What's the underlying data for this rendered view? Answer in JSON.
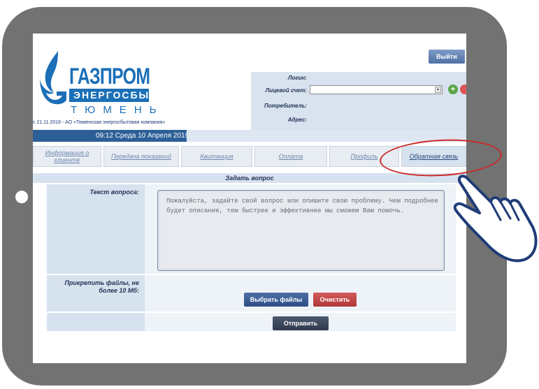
{
  "header": {
    "brand_main": "ГАЗПРОМ",
    "brand_sub": "ЭНЕРГОСБЫТ",
    "brand_city": "ТЮМЕНЬ",
    "company_line": "с 21.11.2018 - АО «Тюменская энергосбытовая компания»",
    "logout_label": "Выйти",
    "info": {
      "login_label": "Логин:",
      "account_label": "Лицевой счет:",
      "consumer_label": "Потребитель:",
      "address_label": "Адрес:",
      "account_value": ""
    }
  },
  "datebar": {
    "date_text": "09:12  Среда  10 Апреля 2019"
  },
  "tabs": [
    {
      "label": "Информация о клиенте"
    },
    {
      "label": "Передача показаний"
    },
    {
      "label": "Квитанция"
    },
    {
      "label": "Оплата"
    },
    {
      "label": "Профиль"
    },
    {
      "label": "Обратная связь"
    }
  ],
  "form": {
    "title": "Задать вопрос",
    "question_label": "Текст вопроса:",
    "question_placeholder": "Пожалуйста, задайте свой вопрос или опишите свою проблему. Чем подробнее будет описание, тем быстрее и эффективнее мы сможем Вам помочь.",
    "attach_label": "Прикрепить файлы, не более 10 Мб:",
    "choose_files_label": "Выбрать файлы",
    "clear_label": "Очистить",
    "send_label": "Отправить"
  },
  "colors": {
    "frame": "#727272",
    "brand_blue": "#1b6fb7",
    "datebar": "#2d5f97",
    "highlight_circle": "#cc2a2a",
    "clear_button": "#c04545"
  },
  "icons": [
    "gazprom-flame-logo",
    "dropdown-arrow-icon",
    "add-icon",
    "remove-icon",
    "hand-pointer-icon"
  ]
}
